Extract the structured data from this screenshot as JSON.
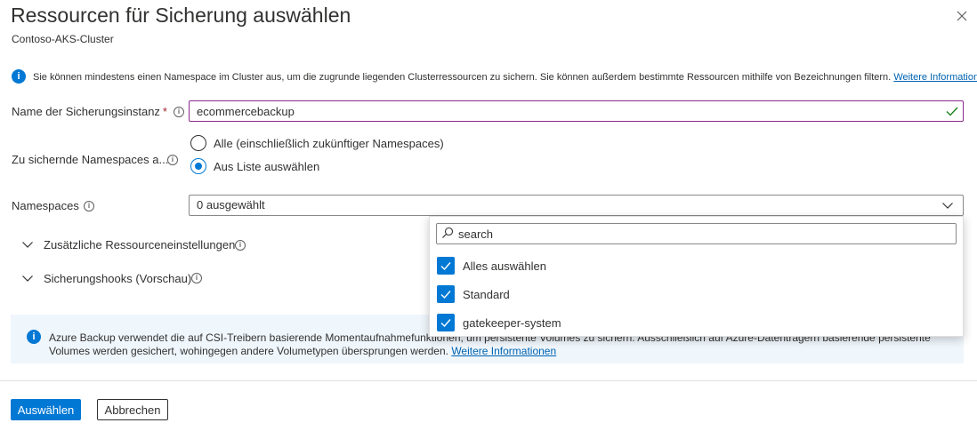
{
  "header": {
    "title": "Ressourcen für Sicherung auswählen",
    "subtitle": "Contoso-AKS-Cluster"
  },
  "info": {
    "text": "Sie können mindestens einen Namespace im Cluster aus, um die zugrunde liegenden Clusterressourcen zu sichern. Sie können außerdem bestimmte Ressourcen mithilfe von Bezeichnungen filtern.",
    "link": "Weitere Informationen"
  },
  "form": {
    "instance_label": "Name der Sicherungsinstanz",
    "required_mark": "*",
    "instance_value": "ecommercebackup",
    "namespaces_to_backup_label": "Zu sichernde Namespaces a...",
    "radio_all": "Alle (einschließlich zukünftiger Namespaces)",
    "radio_list": "Aus Liste auswählen",
    "namespaces_label": "Namespaces",
    "namespaces_value": "0 ausgewählt"
  },
  "expanders": {
    "additional": "Zusätzliche Ressourceneinstellungen",
    "hooks": "Sicherungshooks (Vorschau)"
  },
  "dropdown_panel": {
    "search_placeholder": "search",
    "options": [
      {
        "label": "Alles auswählen",
        "checked": true
      },
      {
        "label": "Standard",
        "checked": true
      },
      {
        "label": "gatekeeper-system",
        "checked": true
      }
    ]
  },
  "banner": {
    "text": "Azure Backup verwendet die auf CSI-Treibern basierende Momentaufnahmefunktionen, um persistente Volumes zu sichern. Ausschließlich auf Azure-Datenträgern basierende persistente Volumes werden gesichert, wohingegen andere Volumetypen übersprungen werden.",
    "link": "Weitere Informationen"
  },
  "buttons": {
    "select": "Auswählen",
    "cancel": "Abbrechen"
  },
  "colors": {
    "accent": "#0078d4",
    "input_focus_border": "#8a2b8a",
    "valid_check": "#107c10",
    "banner_bg": "#eff6fc"
  }
}
